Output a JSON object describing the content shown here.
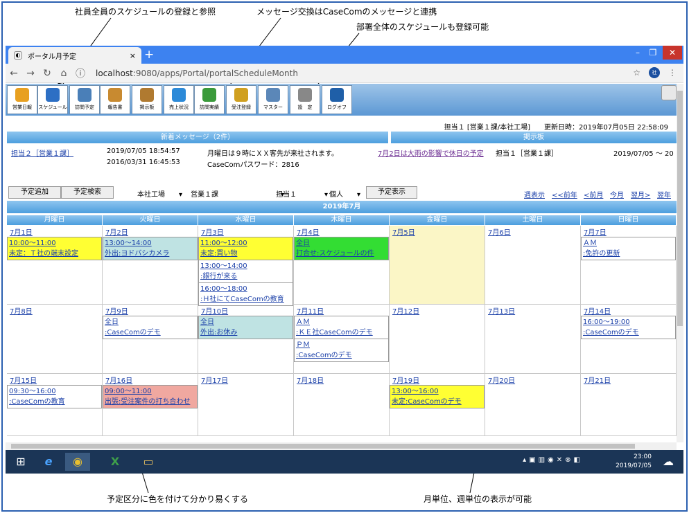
{
  "annotations": {
    "a1": "社員全員のスケジュールの登録と参照",
    "a2": "メッセージ交換はCaseComのメッセージと連携",
    "a3": "部署全体のスケジュールも登録可能",
    "a4": "予定区分に色を付けて分かり易くする",
    "a5": "月単位、週単位の表示が可能"
  },
  "browser": {
    "tab_title": "ポータル月予定",
    "tab_close": "×",
    "new_tab": "+",
    "url_host": "localhost",
    "url_rest": ":9080/apps/Portal/portalScheduleMonth",
    "avatar": "社",
    "win_min": "–",
    "win_max": "❐",
    "win_close": "✕"
  },
  "toolbar": [
    {
      "label": "営業日報",
      "icon": "people-icon",
      "color": "#e8a020"
    },
    {
      "label": "スケジュール",
      "icon": "schedule-people-icon",
      "color": "#2d6fc4"
    },
    {
      "label": "訪問予定",
      "icon": "calendar-clock-icon",
      "color": "#4a7fb8"
    },
    {
      "label": "報告書",
      "icon": "report-icon",
      "color": "#c88a30"
    },
    {
      "label": "掲示板",
      "icon": "board-icon",
      "color": "#b07a30"
    },
    {
      "label": "売上状況",
      "icon": "sales-pie-icon",
      "color": "#2c8ad8"
    },
    {
      "label": "訪問実績",
      "icon": "bar-chart-icon",
      "color": "#3a9a3a"
    },
    {
      "label": "受注登録",
      "icon": "checklist-icon",
      "color": "#d0a020"
    },
    {
      "label": "マスター",
      "icon": "book-icon",
      "color": "#5b87b8"
    },
    {
      "label": "設　定",
      "icon": "tools-icon",
      "color": "#888888"
    },
    {
      "label": "ログオフ",
      "icon": "logoff-icon",
      "color": "#1f5fa8"
    }
  ],
  "info": {
    "user": "担当１ [営業１課/本社工場]",
    "updated": "更新日時：2019年07月05日 22:58:09"
  },
  "panels": {
    "messages_title": "新着メッセージ（2件）",
    "board_title": "掲示板"
  },
  "messages": {
    "sender": "担当２［営業１課］",
    "rows": [
      {
        "datetime": "2019/07/05 18:54:57",
        "text": "月曜日は９時にＸＸ客先が来社されます。"
      },
      {
        "datetime": "2016/03/31 16:45:53",
        "text": "CaseComパスワード：2816"
      }
    ],
    "board_item": "7月2日は大雨の影響で休日の予定",
    "board_author": "担当１［営業１課］",
    "board_date": "2019/07/05 ～ 20"
  },
  "controls": {
    "add_btn": "予定追加",
    "search_btn": "予定検索",
    "site": "本社工場",
    "dept": "営業１課",
    "person": "担当１",
    "scope": "個人",
    "show_btn": "予定表示",
    "nav": [
      "週表示",
      "<<前年",
      "<前月",
      "今月",
      "翌月>",
      "翌年>"
    ]
  },
  "calendar": {
    "title": "2019年7月",
    "days": [
      "月曜日",
      "火曜日",
      "水曜日",
      "木曜日",
      "金曜日",
      "土曜日",
      "日曜日"
    ],
    "weeks": [
      {
        "dates": [
          "7月1日",
          "7月2日",
          "7月3日",
          "7月4日",
          "7月5日",
          "7月6日",
          "7月7日"
        ]
      },
      {
        "dates": [
          "7月8日",
          "7月9日",
          "7月10日",
          "7月11日",
          "7月12日",
          "7月13日",
          "7月14日"
        ]
      },
      {
        "dates": [
          "7月15日",
          "7月16日",
          "7月17日",
          "7月18日",
          "7月19日",
          "7月20日",
          "7月21日"
        ]
      }
    ],
    "events": [
      {
        "week": 0,
        "day": 0,
        "slot": 0,
        "time": "10:00～11:00",
        "title": "未定：Ｔ社の端末設定",
        "color": "#ffff33"
      },
      {
        "week": 0,
        "day": 1,
        "slot": 0,
        "time": "13:00～14:00",
        "title": "外出:ヨドバシカメラ",
        "color": "#bfe3e3"
      },
      {
        "week": 0,
        "day": 2,
        "slot": 0,
        "time": "11:00～12:00",
        "title": "未定:買い物",
        "color": "#ffff33"
      },
      {
        "week": 0,
        "day": 2,
        "slot": 1,
        "time": "13:00～14:00",
        "title": ":銀行が来る",
        "color": "#ffffff"
      },
      {
        "week": 0,
        "day": 2,
        "slot": 2,
        "time": "16:00～18:00",
        "title": ":Ｈ社にてCaseComの教育",
        "color": "#ffffff"
      },
      {
        "week": 0,
        "day": 3,
        "slot": 0,
        "time": "全日",
        "title": "打合せ:スケジュールの件",
        "color": "#33dd33"
      },
      {
        "week": 0,
        "day": 6,
        "slot": 0,
        "time": "ＡＭ",
        "title": ":免許の更新",
        "color": "#ffffff"
      },
      {
        "week": 1,
        "day": 1,
        "slot": 0,
        "time": "全日",
        "title": ":CaseComのデモ",
        "color": "#ffffff"
      },
      {
        "week": 1,
        "day": 2,
        "slot": 0,
        "time": "全日",
        "title": "外出:お休み",
        "color": "#bfe3e3"
      },
      {
        "week": 1,
        "day": 3,
        "slot": 0,
        "time": "ＡＭ",
        "title": ":ＫＥ社CaseComのデモ",
        "color": "#ffffff"
      },
      {
        "week": 1,
        "day": 3,
        "slot": 1,
        "time": "ＰＭ",
        "title": ":CaseComのデモ",
        "color": "#ffffff"
      },
      {
        "week": 1,
        "day": 6,
        "slot": 0,
        "time": "16:00～19:00",
        "title": ":CaseComのデモ",
        "color": "#ffffff"
      },
      {
        "week": 2,
        "day": 0,
        "slot": 0,
        "time": "09:30～16:00",
        "title": ":CaseComの教育",
        "color": "#ffffff"
      },
      {
        "week": 2,
        "day": 1,
        "slot": 0,
        "time": "09:00～11:00",
        "title": "出張:受注案件の打ち合わせ",
        "color": "#f0a8a0"
      },
      {
        "week": 2,
        "day": 4,
        "slot": 0,
        "time": "13:00～16:00",
        "title": "未定:CaseComのデモ",
        "color": "#ffff33"
      }
    ],
    "today_highlight": {
      "week": 0,
      "day": 4,
      "color": "#fbf6c6"
    }
  },
  "taskbar": {
    "time": "23:00",
    "date": "2019/07/05"
  }
}
